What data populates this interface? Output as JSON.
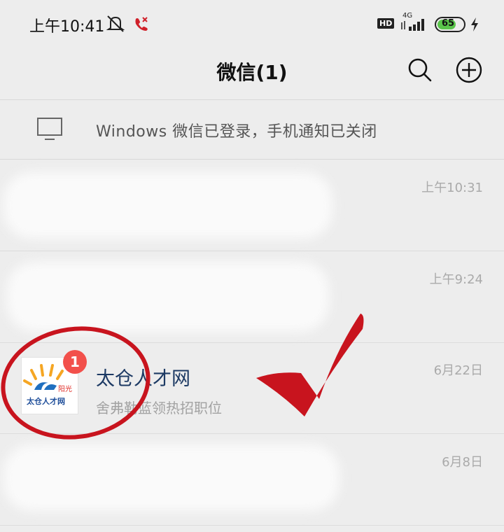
{
  "status_bar": {
    "time": "上午10:41",
    "network": "4G",
    "hd": "HD",
    "battery": "65"
  },
  "header": {
    "title": "微信(1)",
    "search_icon": "search-icon",
    "add_icon": "plus-circle-icon"
  },
  "notice": {
    "icon": "monitor-icon",
    "text": "Windows 微信已登录，手机通知已关闭"
  },
  "chats": [
    {
      "time": "上午10:31"
    },
    {
      "time": "上午9:24"
    },
    {
      "title": "太仓人才网",
      "subtitle": "舍弗勒蓝领热招职位",
      "time": "6月22日",
      "unread": "1",
      "avatar_text_top": "阳光",
      "avatar_text_bottom": "太仓人才网"
    },
    {
      "time": "6月8日"
    }
  ],
  "annotations": {
    "circle": "red-circle",
    "check": "red-checkmark"
  },
  "colors": {
    "background": "#ededed",
    "badge": "#f2504b",
    "annotation": "#c8141e",
    "title": "#1d3a64"
  }
}
